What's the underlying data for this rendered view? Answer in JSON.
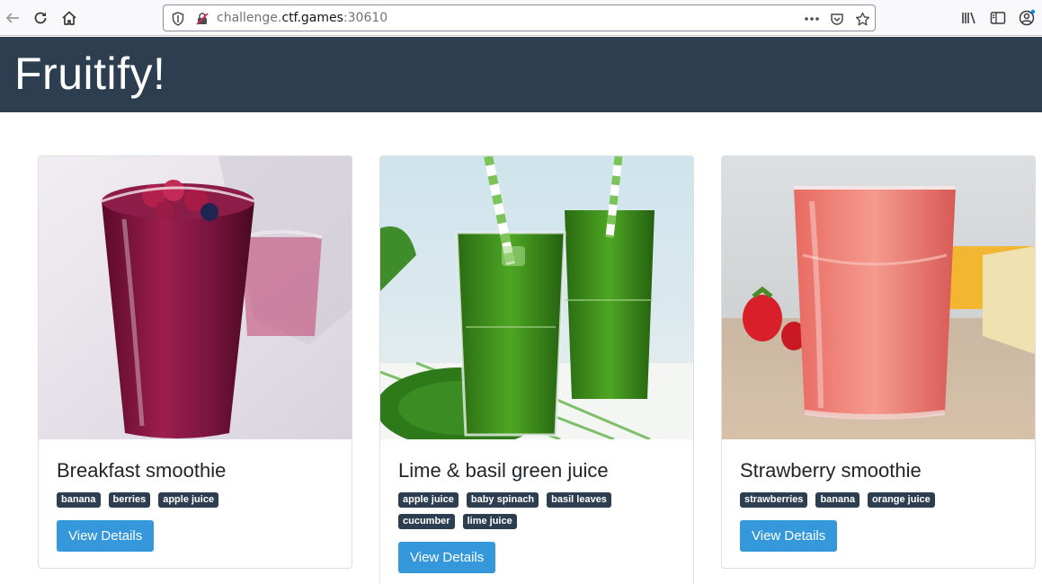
{
  "browser": {
    "url_prefix": "challenge.",
    "url_host": "ctf.games",
    "url_port": ":30610",
    "icons": [
      "back-arrow-icon",
      "reload-icon",
      "home-icon",
      "tracking-shield-icon",
      "insecure-lock-icon",
      "more-icon",
      "pocket-icon",
      "bookmark-star-icon",
      "library-icon",
      "sidebar-icon",
      "account-icon"
    ]
  },
  "site": {
    "title": "Fruitify!",
    "colors": {
      "header": "#2d3e50",
      "tag": "#2d3e50",
      "button": "#3498db"
    }
  },
  "cards": [
    {
      "title": "Breakfast smoothie",
      "tags": [
        "banana",
        "berries",
        "apple juice"
      ],
      "button": "View Details"
    },
    {
      "title": "Lime & basil green juice",
      "tags": [
        "apple juice",
        "baby spinach",
        "basil leaves",
        "cucumber",
        "lime juice"
      ],
      "button": "View Details"
    },
    {
      "title": "Strawberry smoothie",
      "tags": [
        "strawberries",
        "banana",
        "orange juice"
      ],
      "button": "View Details"
    }
  ]
}
